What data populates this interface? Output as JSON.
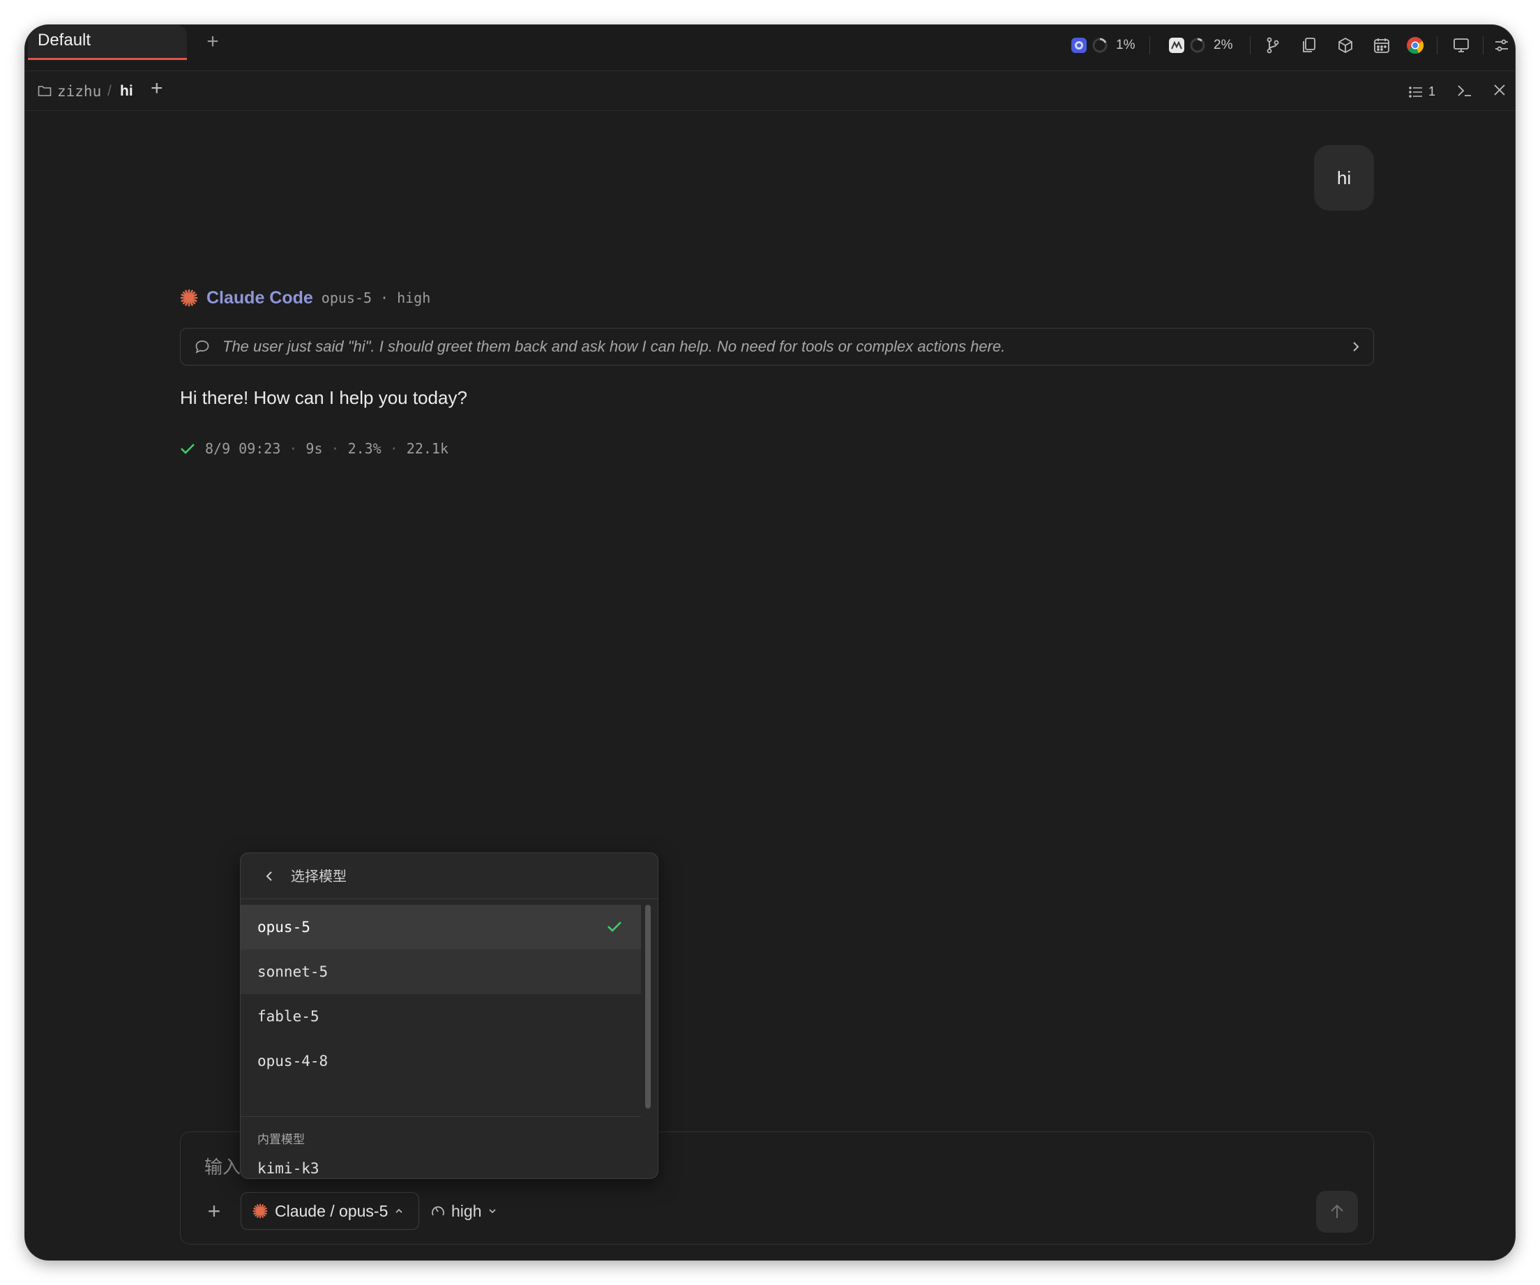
{
  "tabbar": {
    "active_tab": "Default",
    "add_tab_icon": "plus-icon",
    "status1_percent": "1%",
    "status2_percent": "2%",
    "icons": [
      "cpu-app-icon",
      "spinner-icon",
      "memory-app-icon",
      "spinner-icon",
      "git-branch-icon",
      "copy-icon",
      "package-icon",
      "calendar-icon",
      "chrome-icon",
      "monitor-icon",
      "sliders-icon"
    ]
  },
  "breadcrumb": {
    "folder": "zizhu",
    "separator": "/",
    "session": "hi",
    "list_count": "1"
  },
  "conversation": {
    "user_message": "hi",
    "assistant_name": "Claude Code",
    "assistant_model": "opus-5",
    "assistant_effort": "high",
    "meta_dot": "·",
    "thinking": "The user just said \"hi\". I should greet them back and ask how I can help. No need for tools or complex actions here.",
    "reply": "Hi there! How can I help you today?",
    "stats": {
      "time": "8/9 09:23",
      "duration": "9s",
      "context": "2.3%",
      "tokens": "22.1k",
      "dot": "·"
    }
  },
  "model_dropdown": {
    "title": "选择模型",
    "items": [
      {
        "label": "opus-5",
        "selected": true
      },
      {
        "label": "sonnet-5",
        "selected": false
      },
      {
        "label": "fable-5",
        "selected": false
      },
      {
        "label": "opus-4-8",
        "selected": false
      }
    ],
    "section_label": "内置模型",
    "builtin_items": [
      {
        "label": "kimi-k3"
      }
    ]
  },
  "composer": {
    "placeholder_visible": "输入",
    "model_button": "Claude / opus-5",
    "effort_button": "high"
  },
  "colors": {
    "background": "#1d1d1d",
    "accent_tab": "#e0564a",
    "claude_orange": "#e06a4a",
    "assistant_name": "#8f97d8",
    "check_green": "#3fce6a"
  }
}
